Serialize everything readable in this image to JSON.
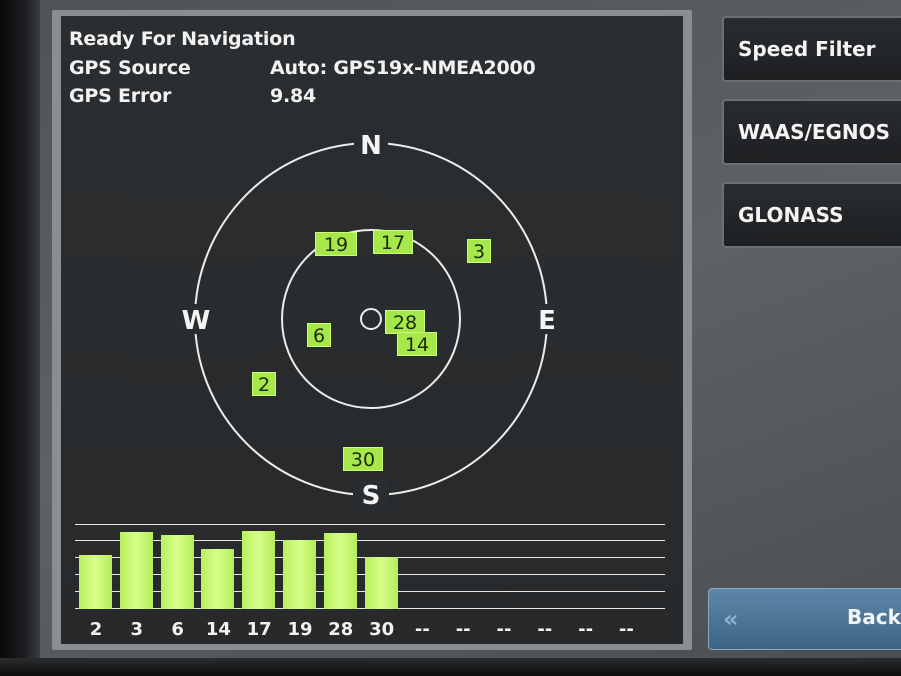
{
  "status": {
    "title": "Ready For Navigation",
    "source_label": "GPS Source",
    "source_value": "Auto: GPS19x-NMEA2000",
    "error_label": "GPS Error",
    "error_value": "9.84"
  },
  "compass": {
    "north": "N",
    "south": "S",
    "east": "E",
    "west": "W"
  },
  "satellites": [
    {
      "id": "19"
    },
    {
      "id": "17"
    },
    {
      "id": "3"
    },
    {
      "id": "6"
    },
    {
      "id": "28"
    },
    {
      "id": "14"
    },
    {
      "id": "2"
    },
    {
      "id": "30"
    }
  ],
  "signal_bars": {
    "labels": [
      "2",
      "3",
      "6",
      "14",
      "17",
      "19",
      "28",
      "30",
      "--",
      "--",
      "--",
      "--",
      "--",
      "--"
    ],
    "levels": [
      0.68,
      0.96,
      0.92,
      0.75,
      0.98,
      0.86,
      0.95,
      0.65,
      0,
      0,
      0,
      0,
      0,
      0
    ]
  },
  "buttons": {
    "speed_filter": "Speed Filter",
    "waas_egnos": "WAAS/EGNOS",
    "glonass": "GLONASS",
    "back": "Back",
    "back_icon": "double-chevron-left-icon"
  },
  "colors": {
    "satellite": "#a6e84a",
    "bar": "#c6f574",
    "screen_bg": "#2a2d2f",
    "back_button": "#4e7698"
  }
}
